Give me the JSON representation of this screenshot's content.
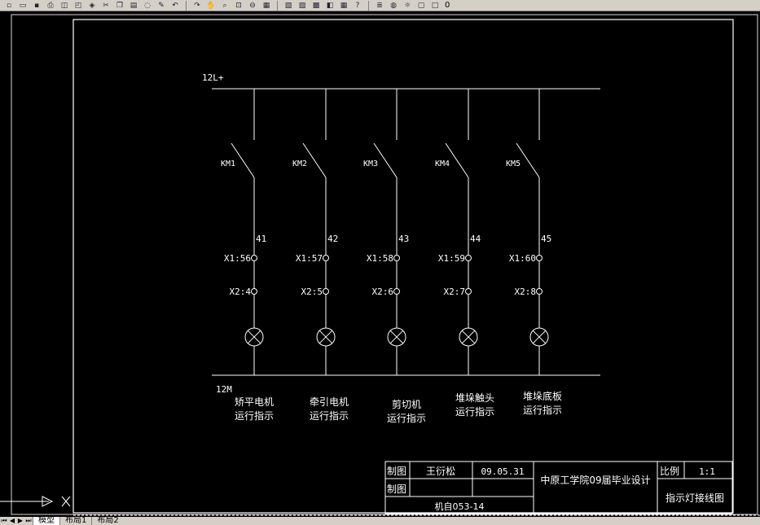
{
  "toolbar": {
    "layer_value": "0",
    "icons": [
      "new-icon",
      "open-icon",
      "save-icon",
      "print-icon",
      "preview-icon",
      "publish-icon",
      "3d-icon",
      "cut-icon",
      "copy-icon",
      "paste-icon",
      "match-icon",
      "brush-icon",
      "undo-icon",
      "redo-icon",
      "pan-icon",
      "zoom-realtime-icon",
      "zoom-window-icon",
      "zoom-previous-icon",
      "properties-icon",
      "designcenter-icon",
      "toolpalette-icon",
      "sheetset-icon",
      "markup-icon",
      "calculator-icon",
      "help-icon",
      "layers-icon",
      "bulb-icon",
      "sun-icon",
      "lock-icon",
      "color-icon"
    ]
  },
  "diagram": {
    "bus_top_label": "12L+",
    "bus_bottom_label": "12M",
    "circuits": [
      {
        "contact": "KM1",
        "wire": "41",
        "t1": "X1:56",
        "t2": "X2:4",
        "desc1": "矫平电机",
        "desc2": "运行指示"
      },
      {
        "contact": "KM2",
        "wire": "42",
        "t1": "X1:57",
        "t2": "X2:5",
        "desc1": "牵引电机",
        "desc2": "运行指示"
      },
      {
        "contact": "KM3",
        "wire": "43",
        "t1": "X1:58",
        "t2": "X2:6",
        "desc1": "剪切机",
        "desc2": "运行指示"
      },
      {
        "contact": "KM4",
        "wire": "44",
        "t1": "X1:59",
        "t2": "X2:7",
        "desc1": "堆垛触头",
        "desc2": "运行指示"
      },
      {
        "contact": "KM5",
        "wire": "45",
        "t1": "X1:60",
        "t2": "X2:8",
        "desc1": "堆垛底板",
        "desc2": "运行指示"
      }
    ]
  },
  "title_block": {
    "drawn_label": "制图",
    "checked_label": "制图",
    "drawn_name": "王衍松",
    "date": "09.05.31",
    "school": "中原工学院09届毕业设计",
    "scale_label": "比例",
    "scale_value": "1:1",
    "drawing_title": "指示灯接线图",
    "class_code": "机自053-14"
  },
  "tabs": {
    "items": [
      "模型",
      "布局1",
      "布局2"
    ],
    "active": 0
  }
}
